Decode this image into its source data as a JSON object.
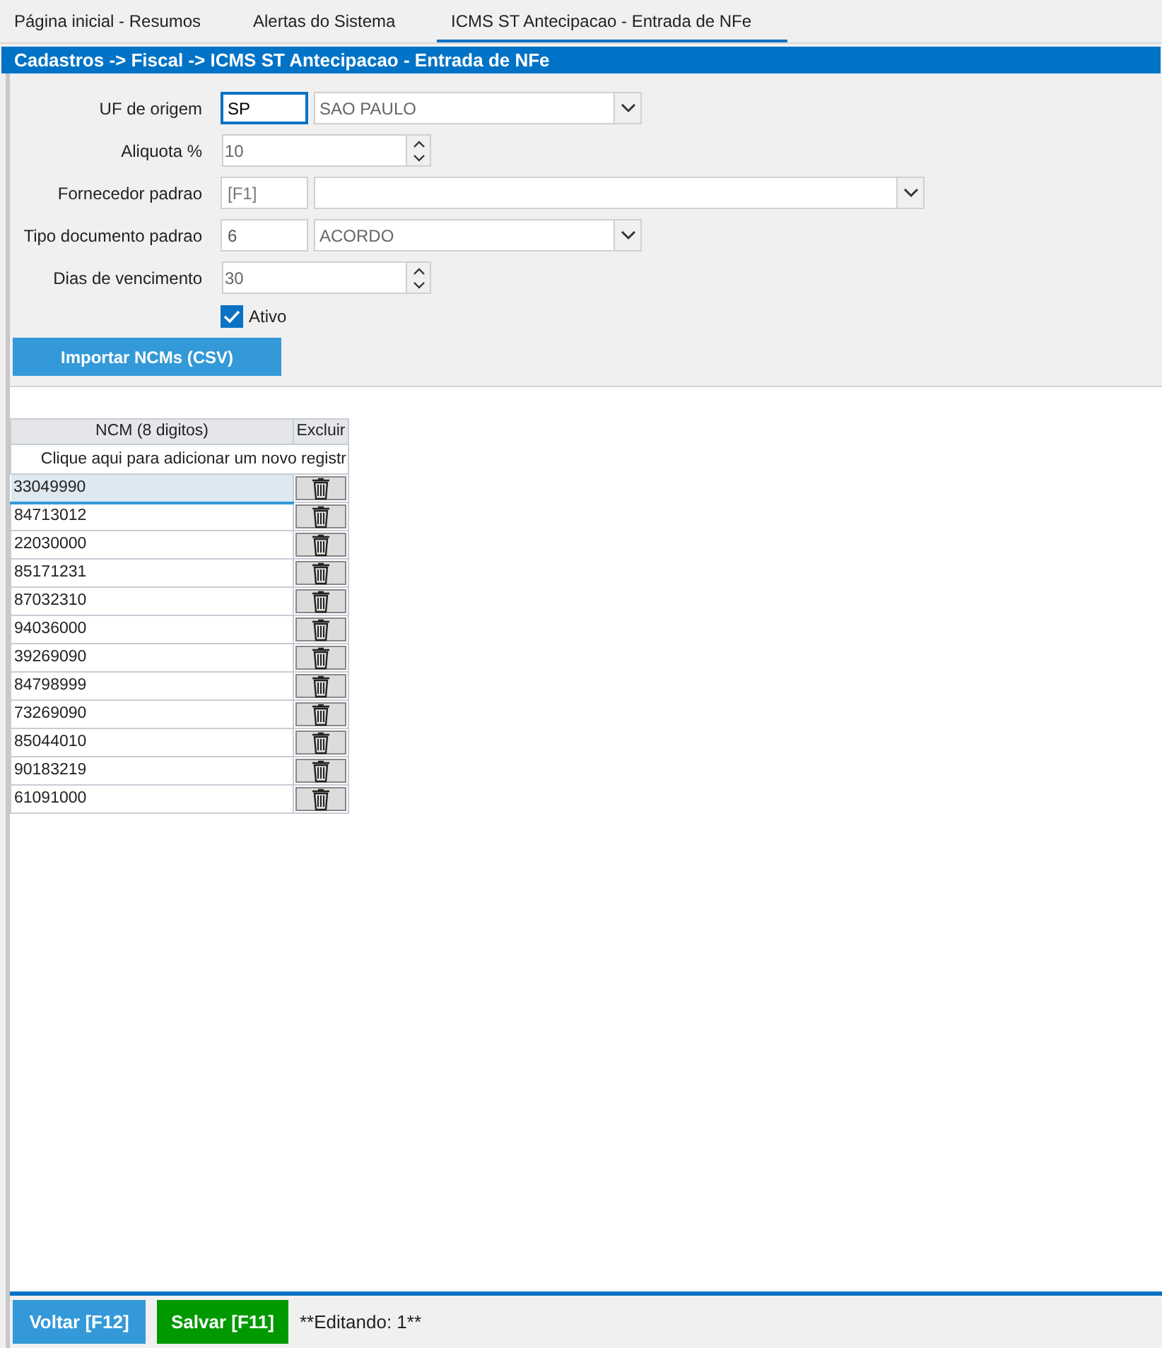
{
  "tabs": [
    {
      "label": "Página inicial - Resumos",
      "selected": false
    },
    {
      "label": "Alertas do Sistema",
      "selected": false
    },
    {
      "label": "ICMS ST Antecipacao - Entrada de NFe",
      "selected": true
    }
  ],
  "breadcrumb": "Cadastros -> Fiscal -> ICMS ST Antecipacao - Entrada de NFe",
  "form": [
    {
      "kind": "lookup",
      "label": "UF de origem",
      "code": "SP",
      "code_focused": true,
      "description": "SAO PAULO",
      "dropdown": true
    },
    {
      "kind": "spin",
      "label": "Aliquota %",
      "value": "10"
    },
    {
      "kind": "lookup",
      "label": "Fornecedor padrao",
      "code_placeholder": "[F1]",
      "code_focused": false,
      "dropdown": true,
      "wide": true
    },
    {
      "kind": "lookup",
      "label": "Tipo documento padrao",
      "code": "6",
      "code_focused": false,
      "description": "ACORDO",
      "dropdown": true
    },
    {
      "kind": "spin",
      "label": "Dias de vencimento",
      "value": "30"
    },
    {
      "kind": "checkbox",
      "label": "Ativo",
      "checked": true
    }
  ],
  "import_button": "Importar NCMs (CSV)",
  "grid": {
    "columns": [
      "NCM (8 digitos)",
      "Excluir"
    ],
    "new_row": "Clique aqui para adicionar um novo registr",
    "rows": [
      {
        "ncm": "33049990",
        "selected": true
      },
      {
        "ncm": "84713012",
        "selected": false
      },
      {
        "ncm": "22030000",
        "selected": false
      },
      {
        "ncm": "85171231",
        "selected": false
      },
      {
        "ncm": "87032310",
        "selected": false
      },
      {
        "ncm": "94036000",
        "selected": false
      },
      {
        "ncm": "39269090",
        "selected": false
      },
      {
        "ncm": "84798999",
        "selected": false
      },
      {
        "ncm": "73269090",
        "selected": false
      },
      {
        "ncm": "85044010",
        "selected": false
      },
      {
        "ncm": "90183219",
        "selected": false
      },
      {
        "ncm": "61091000",
        "selected": false
      }
    ]
  },
  "footer": {
    "back_button": "Voltar [F12]",
    "save_button": "Salvar [F11]",
    "status": "**Editando: 1**"
  }
}
